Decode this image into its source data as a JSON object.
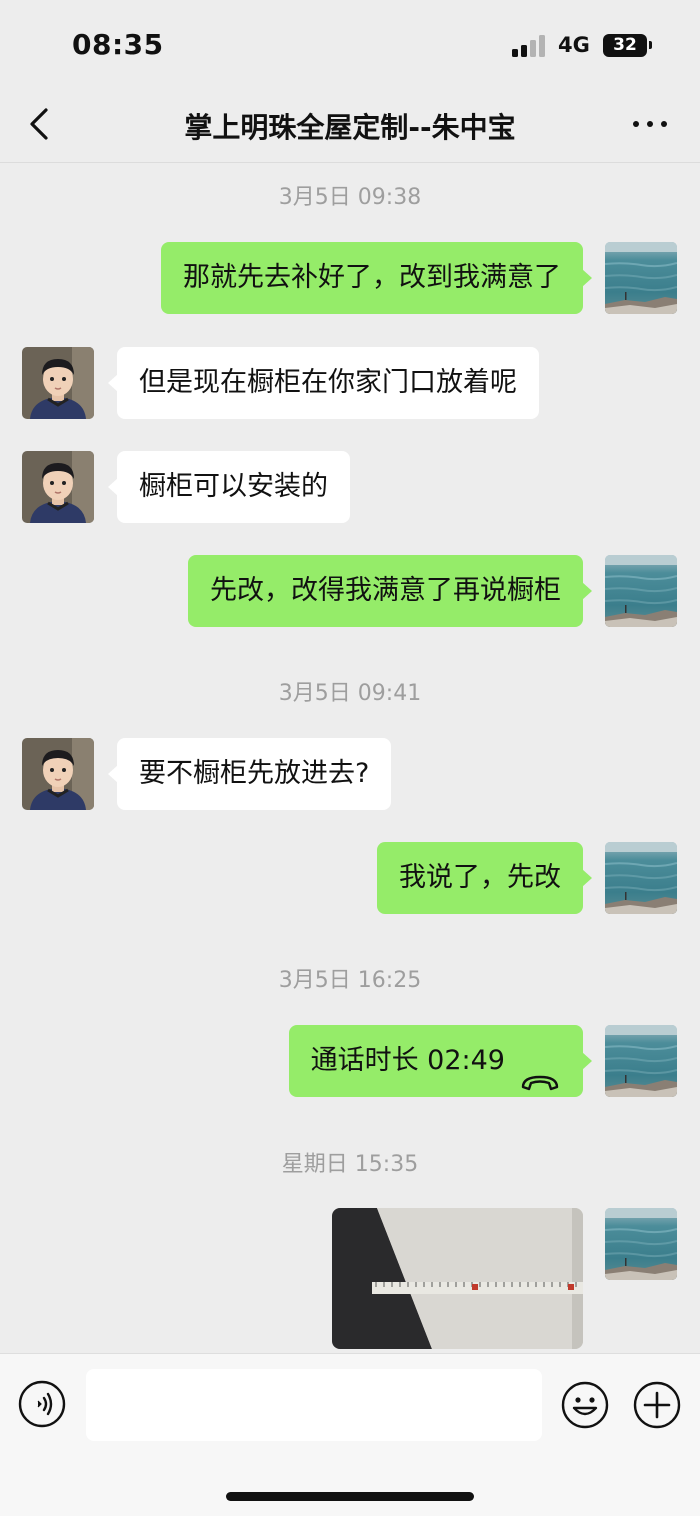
{
  "status_bar": {
    "time": "08:35",
    "network": "4G",
    "battery": "32"
  },
  "header": {
    "title": "掌上明珠全屋定制--朱中宝"
  },
  "messages": [
    {
      "type": "timestamp",
      "text": "3月5日 09:38"
    },
    {
      "type": "text",
      "from": "me",
      "text": "那就先去补好了，改到我满意了"
    },
    {
      "type": "text",
      "from": "contact",
      "text": "但是现在橱柜在你家门口放着呢"
    },
    {
      "type": "text",
      "from": "contact",
      "text": "橱柜可以安装的"
    },
    {
      "type": "text",
      "from": "me",
      "text": "先改，改得我满意了再说橱柜"
    },
    {
      "type": "timestamp",
      "text": "3月5日 09:41"
    },
    {
      "type": "text",
      "from": "contact",
      "text": "要不橱柜先放进去?"
    },
    {
      "type": "text",
      "from": "me",
      "text": "我说了，先改"
    },
    {
      "type": "timestamp",
      "text": "3月5日 16:25"
    },
    {
      "type": "call",
      "from": "me",
      "text": "通话时长 02:49",
      "icon": "phone-hangup-icon"
    },
    {
      "type": "timestamp",
      "text": "星期日 15:35"
    },
    {
      "type": "image",
      "from": "me",
      "description_icon": "photo-measuring-tape"
    }
  ],
  "input_bar": {
    "value": "",
    "placeholder": ""
  },
  "colors": {
    "outgoing_bubble": "#95ec69",
    "incoming_bubble": "#ffffff",
    "background": "#ededed",
    "timestamp": "#9e9e9e"
  }
}
